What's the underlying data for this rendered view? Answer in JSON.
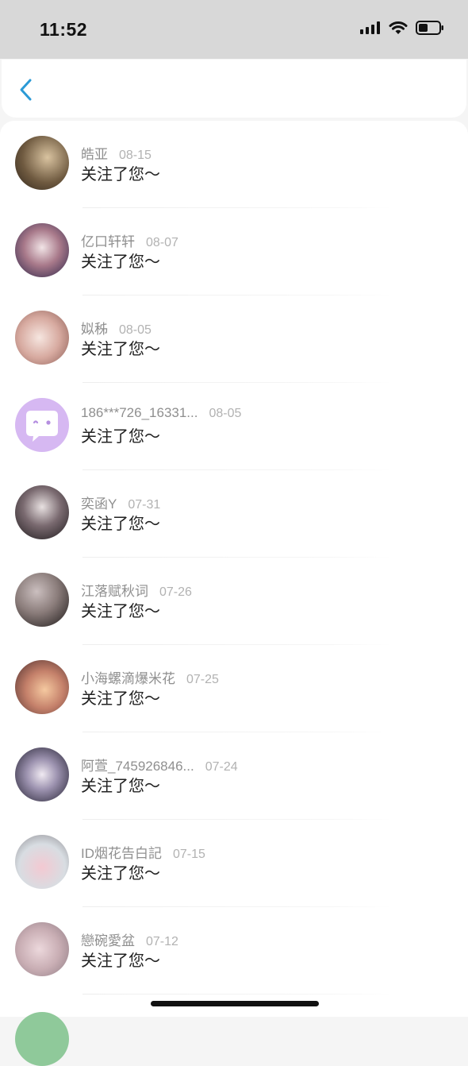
{
  "status": {
    "time": "11:52"
  },
  "header": {
    "back_icon": "chevron-left-icon"
  },
  "notifications": [
    {
      "name": "皓亚",
      "date": "08-15",
      "message": "关注了您～"
    },
    {
      "name": "亿口轩轩",
      "date": "08-07",
      "message": "关注了您～"
    },
    {
      "name": "姒秭",
      "date": "08-05",
      "message": "关注了您～"
    },
    {
      "name": "186***726_16331...",
      "date": "08-05",
      "message": "关注了您～"
    },
    {
      "name": "奕函Y",
      "date": "07-31",
      "message": "关注了您～"
    },
    {
      "name": "江落赋秋词",
      "date": "07-26",
      "message": "关注了您～"
    },
    {
      "name": "小海螺滴爆米花",
      "date": "07-25",
      "message": "关注了您～"
    },
    {
      "name": "阿萱_745926846...",
      "date": "07-24",
      "message": "关注了您～"
    },
    {
      "name": "ID烟花告白記",
      "date": "07-15",
      "message": "关注了您～"
    },
    {
      "name": "戀碗愛盆",
      "date": "07-12",
      "message": "关注了您～"
    }
  ],
  "colors": {
    "accent": "#2b9ad6",
    "status_bar": "#d8d8d8"
  }
}
